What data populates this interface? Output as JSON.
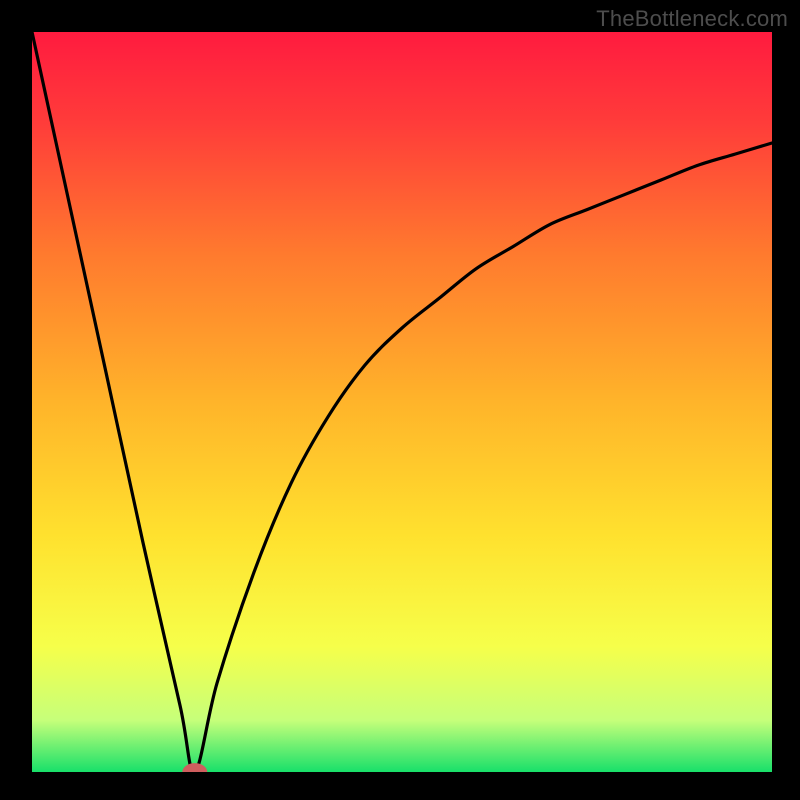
{
  "watermark": "TheBottleneck.com",
  "chart_data": {
    "type": "line",
    "title": "",
    "xlabel": "",
    "ylabel": "",
    "xlim": [
      0,
      100
    ],
    "ylim": [
      0,
      100
    ],
    "grid": false,
    "legend": false,
    "background": {
      "kind": "vertical-gradient",
      "stops": [
        {
          "pct": 0,
          "color": "#ff1b3f"
        },
        {
          "pct": 12,
          "color": "#ff3b3a"
        },
        {
          "pct": 30,
          "color": "#ff7a2e"
        },
        {
          "pct": 50,
          "color": "#ffb42a"
        },
        {
          "pct": 68,
          "color": "#ffe12e"
        },
        {
          "pct": 83,
          "color": "#f6ff4a"
        },
        {
          "pct": 93,
          "color": "#c6ff7a"
        },
        {
          "pct": 100,
          "color": "#18e06a"
        }
      ]
    },
    "curve": {
      "description": "V-shaped black curve with vertex near x≈22, y≈0; left branch nearly straight to (0,100); right branch curves asymptotically toward ~y≈85 at x=100",
      "series": [
        {
          "name": "curve-left",
          "x": [
            0,
            5,
            10,
            15,
            20,
            22
          ],
          "y": [
            100,
            77,
            54,
            31,
            9,
            0
          ]
        },
        {
          "name": "curve-right",
          "x": [
            22,
            25,
            30,
            35,
            40,
            45,
            50,
            55,
            60,
            65,
            70,
            75,
            80,
            85,
            90,
            95,
            100
          ],
          "y": [
            0,
            12,
            27,
            39,
            48,
            55,
            60,
            64,
            68,
            71,
            74,
            76,
            78,
            80,
            82,
            83.5,
            85
          ]
        }
      ]
    },
    "marker": {
      "x": 22,
      "y": 0,
      "color": "#cf5e5e",
      "r": 1.2
    }
  }
}
